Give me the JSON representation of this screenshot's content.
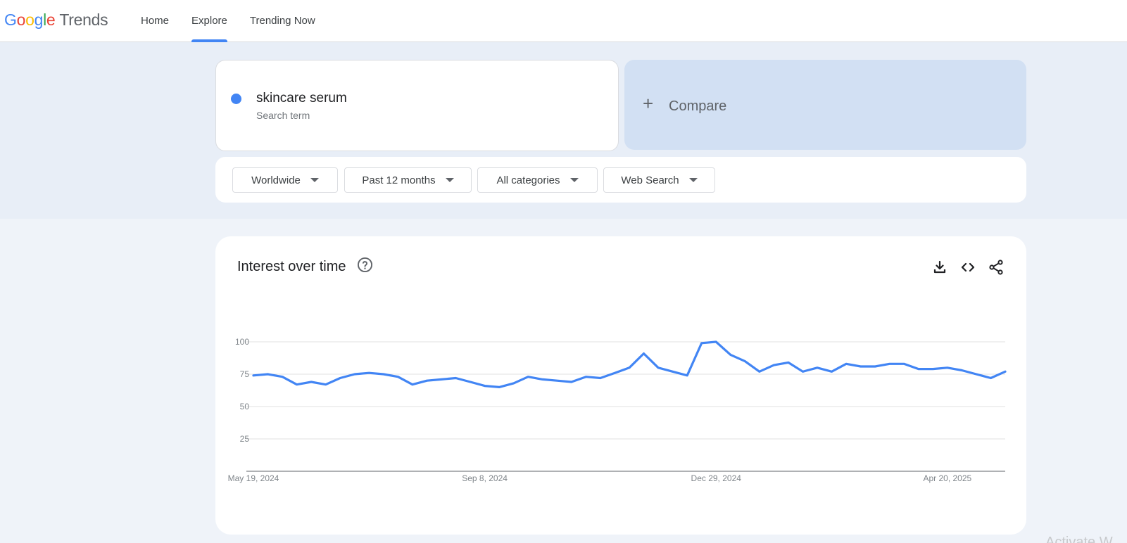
{
  "header": {
    "logo_letters": [
      "G",
      "o",
      "o",
      "g",
      "l",
      "e"
    ],
    "logo_word": "Trends",
    "nav": [
      {
        "label": "Home",
        "active": false
      },
      {
        "label": "Explore",
        "active": true
      },
      {
        "label": "Trending Now",
        "active": false
      }
    ]
  },
  "search": {
    "term": "skincare serum",
    "term_type": "Search term",
    "term_color": "#4285f4",
    "compare_label": "Compare"
  },
  "filters": {
    "region": "Worldwide",
    "time_range": "Past 12 months",
    "category": "All categories",
    "search_type": "Web Search"
  },
  "panel": {
    "title": "Interest over time",
    "icons": [
      "help-icon",
      "download-icon",
      "embed-icon",
      "share-icon"
    ]
  },
  "chart_data": {
    "type": "line",
    "title": "Interest over time",
    "xlabel": "",
    "ylabel": "",
    "ylim": [
      0,
      100
    ],
    "yticks": [
      25,
      50,
      75,
      100
    ],
    "x_tick_labels": [
      "May 19, 2024",
      "Sep 8, 2024",
      "Dec 29, 2024",
      "Apr 20, 2025"
    ],
    "x_tick_indices": [
      0,
      16,
      32,
      48
    ],
    "grid": true,
    "series": [
      {
        "color": "#4285f4",
        "values": [
          74,
          75,
          73,
          67,
          69,
          67,
          72,
          75,
          76,
          75,
          73,
          67,
          70,
          71,
          72,
          69,
          66,
          65,
          68,
          73,
          71,
          70,
          69,
          73,
          72,
          76,
          80,
          91,
          80,
          77,
          74,
          99,
          100,
          90,
          85,
          77,
          82,
          84,
          77,
          80,
          77,
          83,
          81,
          81,
          83,
          83,
          79,
          79,
          80,
          78,
          75,
          72,
          77
        ]
      }
    ]
  },
  "watermark": "Activate W"
}
